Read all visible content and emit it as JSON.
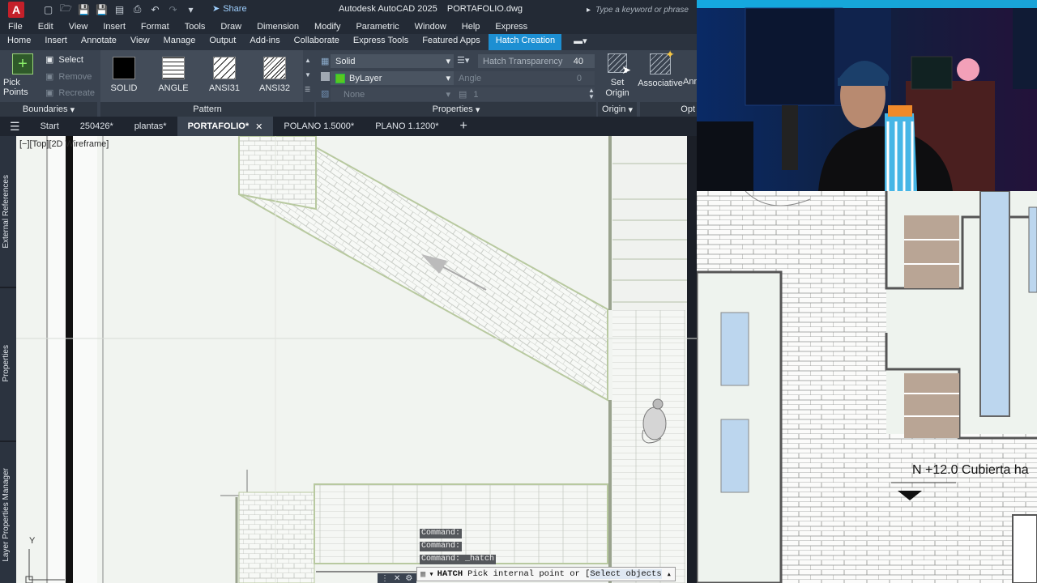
{
  "titlebar": {
    "logo": "A",
    "share": "Share",
    "title": "Autodesk AutoCAD 2025    PORTAFOLIO.dwg",
    "search_placeholder": "Type a keyword or phrase"
  },
  "menus": [
    "File",
    "Edit",
    "View",
    "Insert",
    "Format",
    "Tools",
    "Draw",
    "Dimension",
    "Modify",
    "Parametric",
    "Window",
    "Help",
    "Express"
  ],
  "ribbon_tabs": [
    "Home",
    "Insert",
    "Annotate",
    "View",
    "Manage",
    "Output",
    "Add-ins",
    "Collaborate",
    "Express Tools",
    "Featured Apps",
    "Hatch Creation"
  ],
  "ribbon": {
    "boundaries": {
      "pick_points": "Pick Points",
      "select": "Select",
      "remove": "Remove",
      "recreate": "Recreate",
      "label": "Boundaries"
    },
    "patterns": [
      {
        "name": "SOLID"
      },
      {
        "name": "ANGLE"
      },
      {
        "name": "ANSI31"
      },
      {
        "name": "ANSI32"
      }
    ],
    "pattern_label": "Pattern",
    "properties": {
      "type": "Solid",
      "color": "ByLayer",
      "bg": "None",
      "transparency_label": "Hatch Transparency",
      "transparency_value": "40",
      "angle_label": "Angle",
      "angle_value": "0",
      "scale_value": "1",
      "label": "Properties"
    },
    "origin": {
      "set_origin": "Set Origin",
      "label": "Origin"
    },
    "options": {
      "associative": "Associative",
      "annotative": "Ann",
      "label": "Opt"
    }
  },
  "doc_tabs": [
    "Start",
    "250426*",
    "plantas*",
    "PORTAFOLIO*",
    "POLANO 1.5000*",
    "PLANO 1.1200*"
  ],
  "left_palettes": [
    "External References",
    "Properties",
    "Layer Properties Manager"
  ],
  "viewport_label": "[−][Top][2D Wireframe]",
  "command_history": [
    "Command:",
    "Command:",
    "Command: _hatch"
  ],
  "command_line": {
    "name": "HATCH",
    "prompt": "Pick internal point or [",
    "option": "Select objects"
  },
  "right_plan_text": "N +12.0 Cubierta ha",
  "ucs_y": "Y"
}
